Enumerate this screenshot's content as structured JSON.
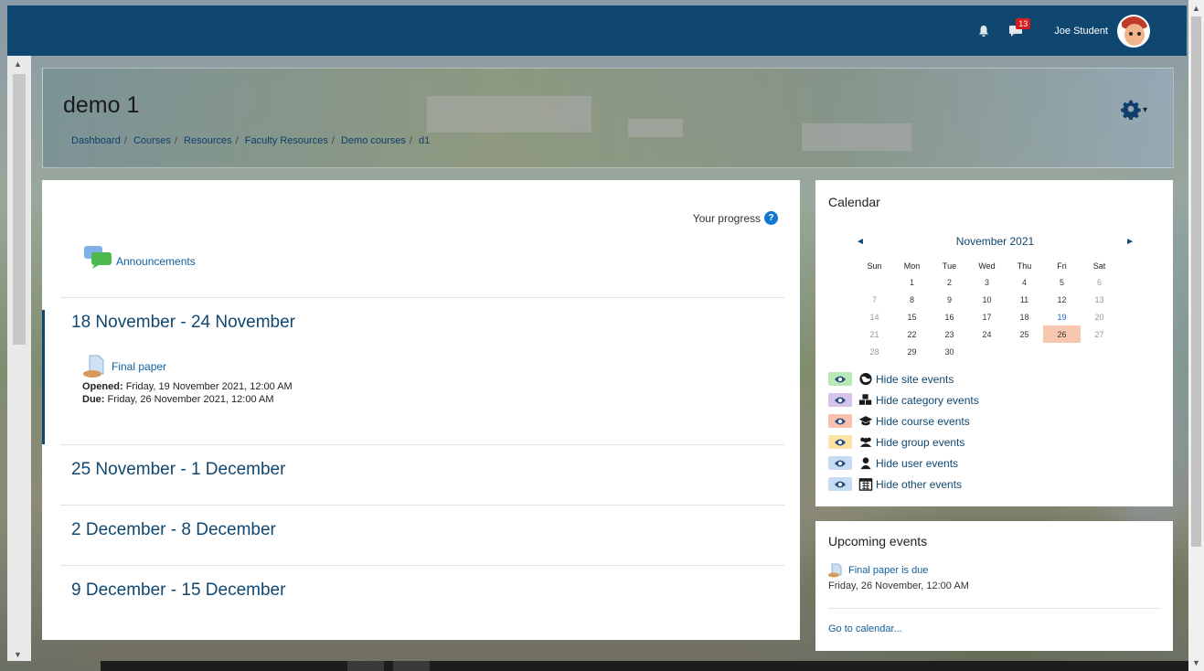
{
  "topbar": {
    "notification_count": "13",
    "username": "Joe Student"
  },
  "header": {
    "course_title": "demo 1",
    "breadcrumb": [
      "Dashboard",
      "Courses",
      "Resources",
      "Faculty Resources",
      "Demo courses",
      "d1"
    ]
  },
  "main": {
    "progress_label": "Your progress",
    "announcements_label": "Announcements",
    "sections": [
      {
        "title": "18 November - 24 November",
        "activity": {
          "name": "Final paper",
          "opened_label": "Opened:",
          "opened_value": "Friday, 19 November 2021, 12:00 AM",
          "due_label": "Due:",
          "due_value": "Friday, 26 November 2021, 12:00 AM"
        }
      },
      {
        "title": "25 November - 1 December"
      },
      {
        "title": "2 December - 8 December"
      },
      {
        "title": "9 December - 15 December"
      }
    ]
  },
  "calendar": {
    "title": "Calendar",
    "month": "November 2021",
    "days": [
      "Sun",
      "Mon",
      "Tue",
      "Wed",
      "Thu",
      "Fri",
      "Sat"
    ],
    "weeks": [
      [
        "",
        "1",
        "2",
        "3",
        "4",
        "5",
        "6"
      ],
      [
        "7",
        "8",
        "9",
        "10",
        "11",
        "12",
        "13"
      ],
      [
        "14",
        "15",
        "16",
        "17",
        "18",
        "19",
        "20"
      ],
      [
        "21",
        "22",
        "23",
        "24",
        "25",
        "26",
        "27"
      ],
      [
        "28",
        "29",
        "30",
        "",
        "",
        "",
        ""
      ]
    ],
    "today": "26",
    "event_day": "19",
    "filters": [
      {
        "label": "Hide site events",
        "color": "#b7eab7",
        "icon": "globe-icon"
      },
      {
        "label": "Hide category events",
        "color": "#d6c3ea",
        "icon": "cubes-icon"
      },
      {
        "label": "Hide course events",
        "color": "#f7c1ad",
        "icon": "graduation-cap-icon"
      },
      {
        "label": "Hide group events",
        "color": "#fbe3a6",
        "icon": "users-icon"
      },
      {
        "label": "Hide user events",
        "color": "#c7dcf2",
        "icon": "user-icon"
      },
      {
        "label": "Hide other events",
        "color": "#c7dcf2",
        "icon": "calendar-icon"
      }
    ]
  },
  "upcoming": {
    "title": "Upcoming events",
    "event_name": "Final paper is due",
    "event_when": "Friday, 26 November, 12:00 AM",
    "goto_label": "Go to calendar..."
  },
  "colors": {
    "brand": "#0f4771",
    "link": "#0f5e9c",
    "badge": "#d71b1b",
    "today": "#f7c7b0"
  }
}
